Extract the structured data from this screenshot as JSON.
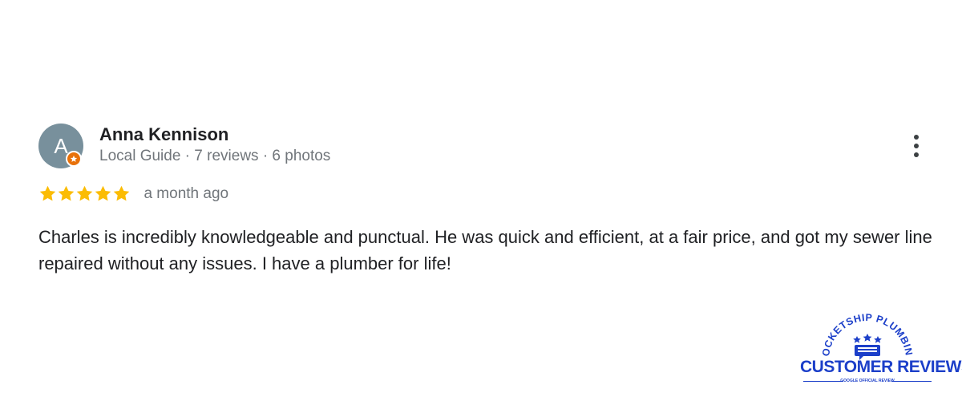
{
  "review": {
    "reviewer": {
      "avatar_initial": "A",
      "avatar_color": "#78909c",
      "badge_icon": "local-guide-star-icon",
      "badge_color": "#e8710a",
      "name": "Anna Kennison",
      "meta": "Local Guide · 7 reviews · 6 photos"
    },
    "rating": 5,
    "rating_max": 5,
    "star_color": "#fbbc04",
    "date": "a month ago",
    "text": "Charles is incredibly knowledgeable and punctual. He was quick and efficient, at a fair price, and got my sewer line repaired without any issues. I have a plumber for life!",
    "menu_icon": "more-vert-icon"
  },
  "brand": {
    "arc_text": "ROCKETSHIP PLUMBING",
    "title": "CUSTOMER REVIEWS",
    "subtitle": "GOOGLE OFFICIAL REVIEW",
    "color": "#1c3fc9"
  }
}
